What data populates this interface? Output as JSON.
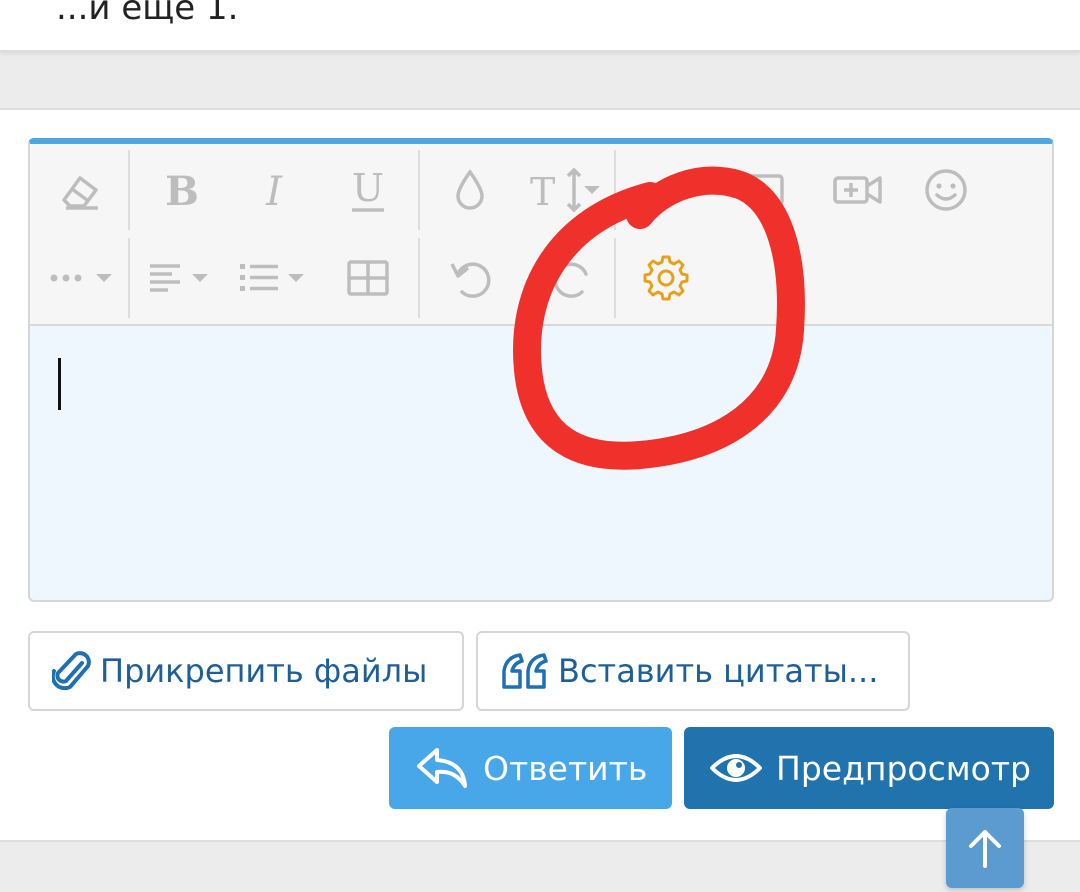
{
  "header": {
    "more_text": "...и еще 1."
  },
  "editor": {
    "toolbar_icons": [
      "eraser-icon",
      "bold-icon",
      "italic-icon",
      "underline-icon",
      "text-color-icon",
      "font-size-icon",
      "link-icon",
      "image-icon",
      "video-icon",
      "emoji-icon",
      "more-options-icon",
      "align-icon",
      "list-icon",
      "table-icon",
      "undo-icon",
      "redo-icon",
      "gear-icon"
    ],
    "accent_color": "#4fa6e0",
    "gear_color": "#e8a11c"
  },
  "actions": {
    "attach_label": "Прикрепить файлы",
    "quotes_label": "Вставить цитаты..."
  },
  "submit": {
    "reply_label": "Ответить",
    "preview_label": "Предпросмотр"
  },
  "annotation": {
    "color": "#f0302b"
  }
}
